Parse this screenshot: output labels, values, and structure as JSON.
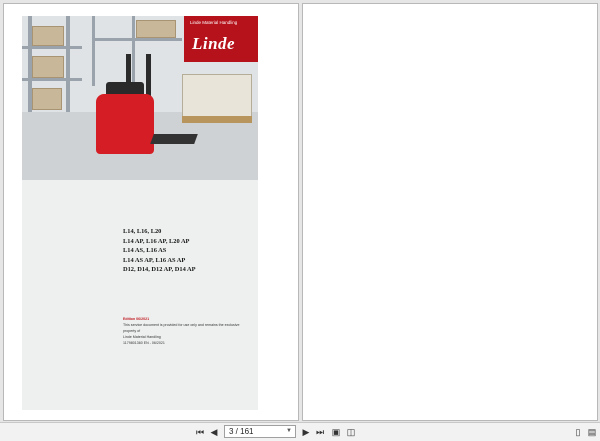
{
  "cover": {
    "brand_caption": "Linde Material Handling",
    "brand_logo": "Linde",
    "models": [
      "L14, L16, L20",
      "L14 AP, L16 AP, L20 AP",
      "L14 AS, L16 AS",
      "L14 AS AP, L16 AS AP",
      "D12, D14, D12 AP, D14 AP"
    ],
    "edition_title": "Edition 06/2021",
    "edition_lines": [
      "This service document is provided for use only and remains the exclusive property of",
      "Linde Material Handling",
      "1179801360 EN - 06/2021"
    ]
  },
  "toolbar": {
    "page_indicator": "3 / 161",
    "icons": [
      "first-page-icon",
      "prev-page-icon",
      "next-page-icon",
      "last-page-icon",
      "fit-page-icon",
      "two-page-icon",
      "single-page-view-icon",
      "continuous-view-icon"
    ]
  },
  "colors": {
    "brand_red": "#b5121b",
    "background": "#e6e6e6"
  }
}
